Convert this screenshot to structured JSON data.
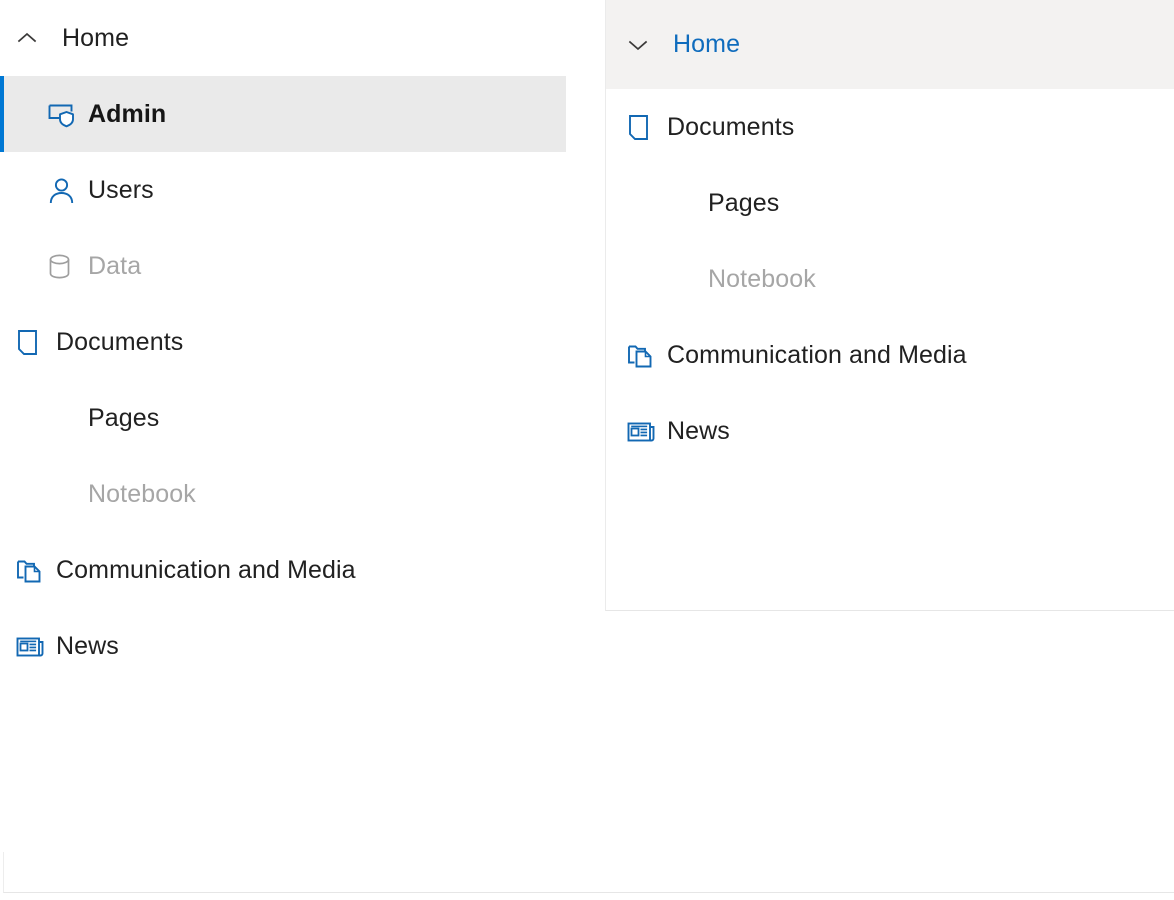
{
  "theme": {
    "accent": "#0078d4",
    "icon_blue": "#1268b3",
    "link_blue": "#0f6cbd",
    "text": "#212121",
    "text_disabled": "#a6a6a6",
    "selected_bg": "#eaeaea",
    "panel_header_bg": "#f3f2f1",
    "icon_disabled": "#9e9e9e"
  },
  "left_nav": {
    "header": {
      "label": "Home",
      "chevron_icon": "chevron-up-icon",
      "expanded": true
    },
    "items": [
      {
        "label": "Admin",
        "icon": "admin-shield-icon",
        "level": 2,
        "selected": true,
        "disabled": false,
        "bold": true
      },
      {
        "label": "Users",
        "icon": "person-icon",
        "level": 2,
        "selected": false,
        "disabled": false,
        "bold": false
      },
      {
        "label": "Data",
        "icon": "database-icon",
        "level": 2,
        "selected": false,
        "disabled": true,
        "bold": false
      },
      {
        "label": "Documents",
        "icon": "document-icon",
        "level": 1,
        "selected": false,
        "disabled": false,
        "bold": false
      },
      {
        "label": "Pages",
        "icon": "",
        "level": 2,
        "selected": false,
        "disabled": false,
        "bold": false
      },
      {
        "label": "Notebook",
        "icon": "",
        "level": 2,
        "selected": false,
        "disabled": true,
        "bold": false
      },
      {
        "label": "Communication and Media",
        "icon": "copy-documents-icon",
        "level": 1,
        "selected": false,
        "disabled": false,
        "bold": false
      },
      {
        "label": "News",
        "icon": "newspaper-icon",
        "level": 1,
        "selected": false,
        "disabled": false,
        "bold": false
      }
    ]
  },
  "right_panel": {
    "header": {
      "label": "Home",
      "chevron_icon": "chevron-down-icon",
      "expanded": true,
      "highlighted": true
    },
    "items": [
      {
        "label": "Documents",
        "icon": "document-icon",
        "level": 1,
        "disabled": false
      },
      {
        "label": "Pages",
        "icon": "",
        "level": 2,
        "disabled": false
      },
      {
        "label": "Notebook",
        "icon": "",
        "level": 2,
        "disabled": true
      },
      {
        "label": "Communication and Media",
        "icon": "copy-documents-icon",
        "level": 1,
        "disabled": false
      },
      {
        "label": "News",
        "icon": "newspaper-icon",
        "level": 1,
        "disabled": false
      }
    ]
  }
}
